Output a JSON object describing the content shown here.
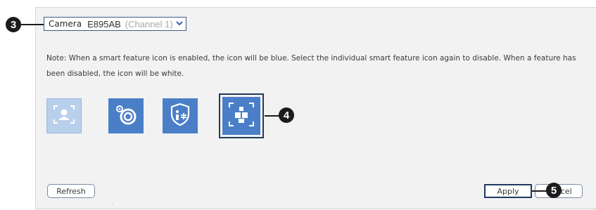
{
  "camera": {
    "label": "Camera",
    "name": "E895AB",
    "channel": "(Channel 1)"
  },
  "note": "Note: When a smart feature icon is enabled, the icon will be blue. Select the individual smart feature icon again to disable. When a feature has been disabled, the icon will be white.",
  "features": [
    {
      "icon": "person-detection-icon",
      "state": "disabled"
    },
    {
      "icon": "camera-lens-icon",
      "state": "enabled"
    },
    {
      "icon": "shield-person-icon",
      "state": "enabled"
    },
    {
      "icon": "object-boxes-icon",
      "state": "enabled-selected"
    }
  ],
  "callouts": {
    "camera": "3",
    "feature": "4",
    "apply": "5"
  },
  "buttons": {
    "refresh": "Refresh",
    "apply": "Apply",
    "cancel": "Cancel"
  },
  "colors": {
    "accent": "#4a7fc8",
    "disabled": "#b9d0ec",
    "outline": "#213a60"
  }
}
